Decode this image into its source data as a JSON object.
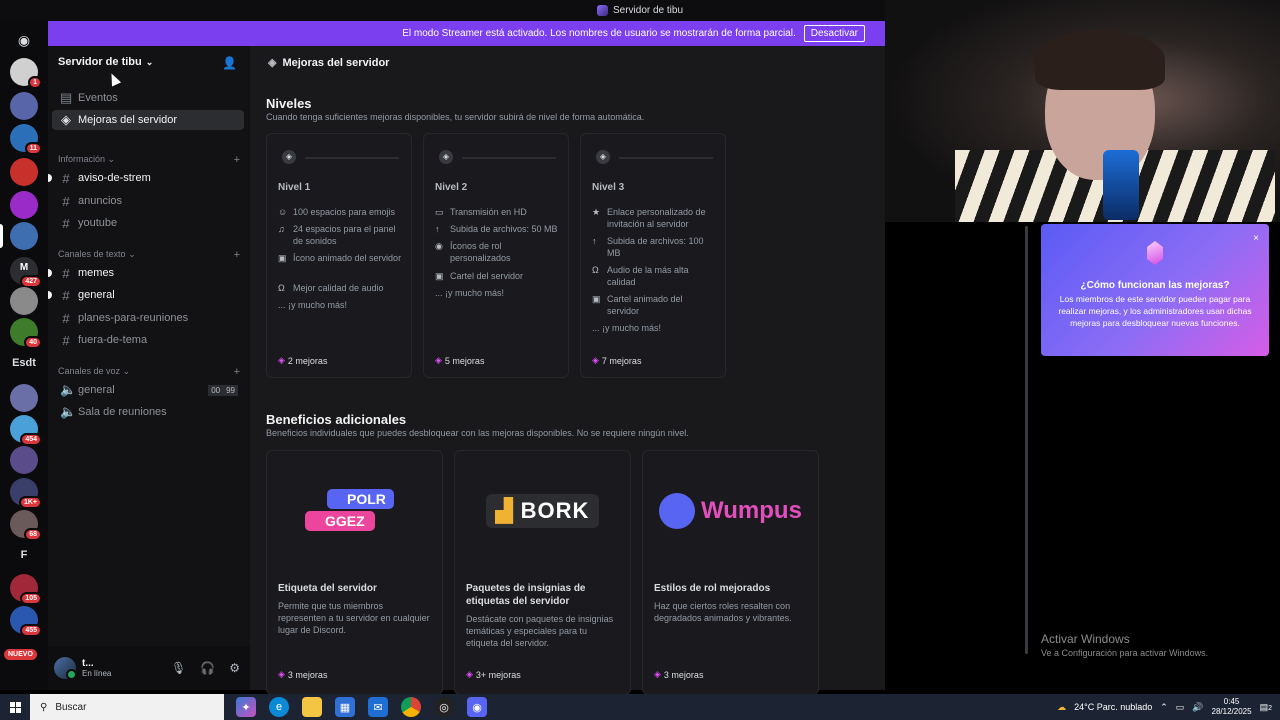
{
  "window": {
    "title": "Servidor de tibu"
  },
  "banner": {
    "text": "El modo Streamer está activado. Los nombres de usuario se mostrarán de forma parcial.",
    "button": "Desactivar"
  },
  "rail": {
    "badges": [
      "1",
      "11",
      "427",
      "40",
      "454",
      "1K+",
      "68",
      "105",
      "455"
    ],
    "text_items": [
      "Esdt",
      "F",
      "M"
    ],
    "new_label": "NUEVO"
  },
  "sidebar": {
    "server_name": "Servidor de tibu",
    "top_items": [
      {
        "label": "Eventos"
      },
      {
        "label": "Mejoras del servidor"
      }
    ],
    "categories": [
      {
        "label": "Información",
        "channels": [
          "aviso-de-strem",
          "anuncios",
          "youtube"
        ]
      },
      {
        "label": "Canales de texto",
        "channels": [
          "memes",
          "general",
          "planes-para-reuniones",
          "fuera-de-tema"
        ]
      },
      {
        "label": "Canales de voz",
        "channels": [
          "general",
          "Sala de reuniones"
        ]
      }
    ],
    "voice_counts": [
      "00",
      "99"
    ]
  },
  "user": {
    "name": "t...",
    "status": "En línea"
  },
  "main": {
    "header": "Mejoras del servidor",
    "levels_title": "Niveles",
    "levels_sub": "Cuando tenga suficientes mejoras disponibles, tu servidor subirá de nivel de forma automática.",
    "levels": [
      {
        "title": "Nivel 1",
        "perks": [
          "100 espacios para emojis",
          "24 espacios para el panel de sonidos",
          "Ícono animado del servidor",
          "Mejor calidad de audio"
        ],
        "more": "... ¡y mucho más!",
        "boosts": "2 mejoras"
      },
      {
        "title": "Nivel 2",
        "perks": [
          "Transmisión en HD",
          "Subida de archivos: 50 MB",
          "Íconos de rol personalizados",
          "Cartel del servidor"
        ],
        "more": "... ¡y mucho más!",
        "boosts": "5 mejoras"
      },
      {
        "title": "Nivel 3",
        "perks": [
          "Enlace personalizado de invitación al servidor",
          "Subida de archivos: 100 MB",
          "Audio de la más alta calidad",
          "Cartel animado del servidor"
        ],
        "more": "... ¡y mucho más!",
        "boosts": "7 mejoras"
      }
    ],
    "benefits_title": "Beneficios adicionales",
    "benefits_sub": "Beneficios individuales que puedes desbloquear con las mejoras disponibles. No se requiere ningún nivel.",
    "benefits": [
      {
        "art": [
          "POLR",
          "GGEZ"
        ],
        "title": "Etiqueta del servidor",
        "desc": "Permite que tus miembros representen a tu servidor en cualquier lugar de Discord.",
        "boosts": "3 mejoras"
      },
      {
        "art": [
          "BORK"
        ],
        "title": "Paquetes de insignias de etiquetas del servidor",
        "desc": "Destácate con paquetes de insignias temáticas y especiales para tu etiqueta del servidor.",
        "boosts": "3+ mejoras"
      },
      {
        "art": [
          "Wumpus"
        ],
        "title": "Estilos de rol mejorados",
        "desc": "Haz que ciertos roles resalten con degradados animados y vibrantes.",
        "boosts": "3 mejoras"
      }
    ]
  },
  "tip": {
    "title": "¿Cómo funcionan las mejoras?",
    "body": "Los miembros de este servidor pueden pagar para realizar mejoras, y los administradores usan dichas mejoras para desbloquear nuevas funciones."
  },
  "activate": {
    "line1": "Activar Windows",
    "line2": "Ve a Configuración para activar Windows."
  },
  "taskbar": {
    "search_placeholder": "Buscar",
    "weather": "24°C  Parc. nublado",
    "time": "0:45",
    "date": "28/12/2025",
    "notifications": "2"
  }
}
